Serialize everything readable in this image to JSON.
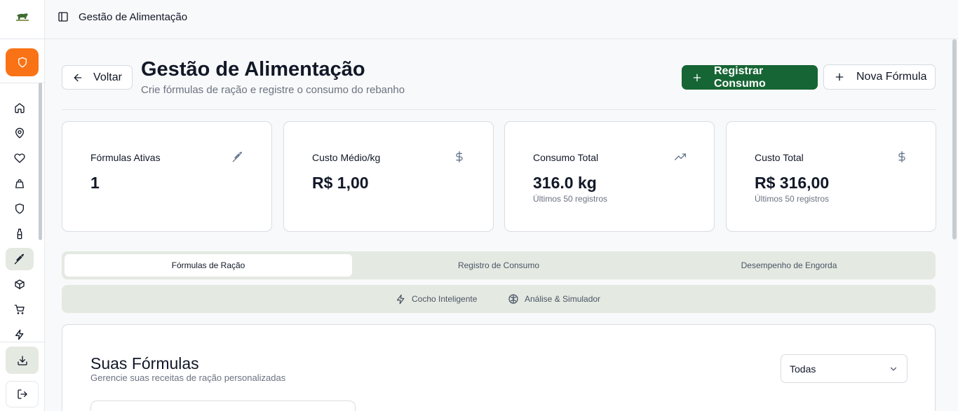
{
  "app": {
    "title": "Gestão de Alimentação"
  },
  "sidebar": {
    "logo": "cattle-logo",
    "badge_icon": "shield-icon",
    "items": [
      {
        "name": "home-icon"
      },
      {
        "name": "map-pin-icon"
      },
      {
        "name": "heart-icon"
      },
      {
        "name": "bag-icon"
      },
      {
        "name": "shield-icon"
      },
      {
        "name": "bottle-icon"
      },
      {
        "name": "wheat-icon",
        "active": true
      },
      {
        "name": "package-icon"
      },
      {
        "name": "cart-icon"
      },
      {
        "name": "zap-icon"
      }
    ],
    "download_icon": "download-icon",
    "logout_icon": "logout-icon"
  },
  "header": {
    "back_label": "Voltar",
    "title": "Gestão de Alimentação",
    "subtitle": "Crie fórmulas de ração e registre o consumo do rebanho",
    "primary_label": "Registrar Consumo",
    "secondary_label": "Nova Fórmula"
  },
  "stats": [
    {
      "label": "Fórmulas Ativas",
      "value": "1",
      "sub": "",
      "icon": "wheat-icon"
    },
    {
      "label": "Custo Médio/kg",
      "value": "R$ 1,00",
      "sub": "",
      "icon": "dollar-icon"
    },
    {
      "label": "Consumo Total",
      "value": "316.0 kg",
      "sub": "Últimos 50 registros",
      "icon": "trending-up-icon"
    },
    {
      "label": "Custo Total",
      "value": "R$ 316,00",
      "sub": "Últimos 50 registros",
      "icon": "dollar-icon"
    }
  ],
  "tabs": [
    "Fórmulas de Ração",
    "Registro de Consumo",
    "Desempenho de Engorda"
  ],
  "subtabs": [
    "Cocho Inteligente",
    "Análise & Simulador"
  ],
  "formulas": {
    "title": "Suas Fórmulas",
    "subtitle": "Gerencie suas receitas de ração personalizadas",
    "filter_value": "Todas"
  },
  "colors": {
    "primary": "#166534",
    "accent": "#f97316",
    "tab_bg": "#e4e9e2"
  }
}
